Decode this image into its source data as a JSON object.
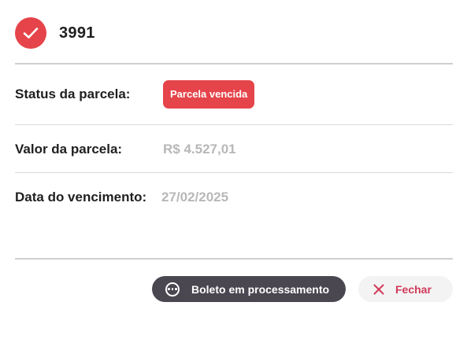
{
  "header": {
    "title": "3991",
    "icon": "check-circle-icon",
    "accent": "#e5444a"
  },
  "details": {
    "status_label": "Status da parcela:",
    "status_badge": "Parcela vencida",
    "amount_label": "Valor da parcela:",
    "amount_value": "R$ 4.527,01",
    "due_label": "Data do vencimento:",
    "due_value": "27/02/2025"
  },
  "actions": {
    "boleto_label": "Boleto em processamento",
    "boleto_icon": "more-horizontal-circle-icon",
    "close_label": "Fechar",
    "close_icon": "close-icon"
  },
  "colors": {
    "danger": "#e5444a",
    "dark_button": "#4a4750",
    "close_text": "#d13a5a",
    "muted_value": "#b8b8b8"
  }
}
